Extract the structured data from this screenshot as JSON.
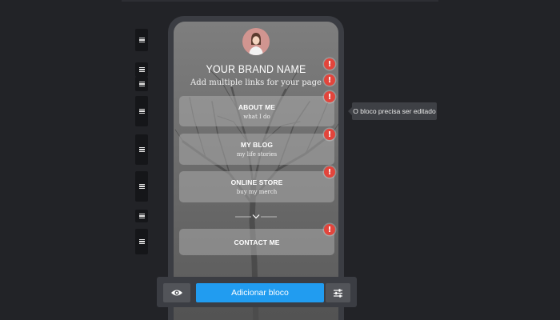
{
  "profile": {
    "brand_name": "YOUR BRAND NAME",
    "tagline": "Add multiple links for your page"
  },
  "links": [
    {
      "title": "ABOUT ME",
      "subtitle": "what I do"
    },
    {
      "title": "MY BLOG",
      "subtitle": "my life stories"
    },
    {
      "title": "ONLINE STORE",
      "subtitle": "buy my merch"
    },
    {
      "title": "CONTACT ME",
      "subtitle": ""
    }
  ],
  "tooltip": {
    "text": "O bloco precisa ser editado"
  },
  "warning_badge": {
    "glyph": "!"
  },
  "toolbar": {
    "add_block_label": "Adicionar bloco"
  },
  "colors": {
    "background": "#222327",
    "accent": "#219cf0",
    "warning": "#e2453c",
    "card": "#3b3d43"
  }
}
